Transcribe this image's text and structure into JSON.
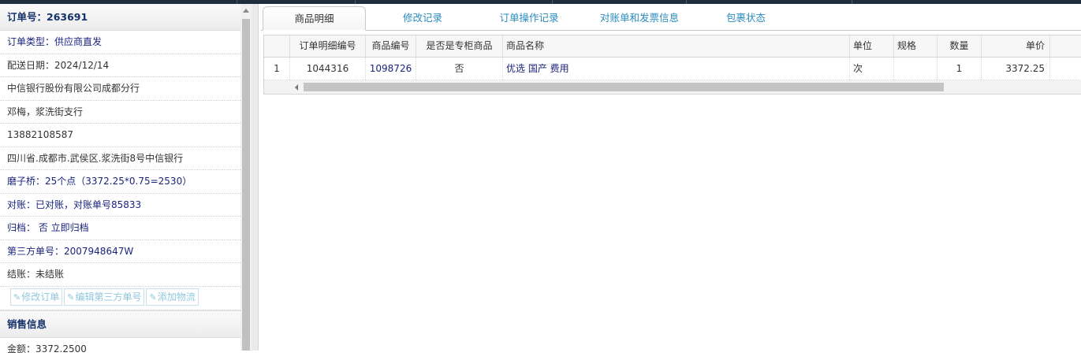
{
  "order": {
    "header": "订单号：263691",
    "rows": [
      {
        "text": "订单类型：供应商直发",
        "style": "blue"
      },
      {
        "text": "配送日期：2024/12/14",
        "style": "dark"
      },
      {
        "text": "中信银行股份有限公司成都分行",
        "style": "dark"
      },
      {
        "text": "邓梅，浆洗街支行",
        "style": "dark"
      },
      {
        "text": "13882108587",
        "style": "dark"
      },
      {
        "text": "四川省.成都市.武侯区.浆洗街8号中信银行",
        "style": "dark"
      },
      {
        "text": "磨子桥：25个点（3372.25*0.75=2530）",
        "style": "blue"
      },
      {
        "text": "对账：已对账，对账单号85833",
        "style": "blue"
      },
      {
        "text": "归档： 否 立即归档",
        "style": "blue"
      },
      {
        "text": "第三方单号：2007948647W",
        "style": "blue"
      },
      {
        "text": "结账：未结账",
        "style": "dark"
      }
    ],
    "buttons": {
      "edit_order": "修改订单",
      "edit_third_party": "编辑第三方单号",
      "add_logistics": "添加物流"
    }
  },
  "sales": {
    "header": "销售信息",
    "amount": "金额：3372.2500"
  },
  "tabs": [
    "商品明细",
    "修改记录",
    "订单操作记录",
    "对账单和发票信息",
    "包裹状态"
  ],
  "grid": {
    "columns": [
      "订单明细编号",
      "商品编号",
      "是否是专柜商品",
      "商品名称",
      "单位",
      "规格",
      "数量",
      "单价"
    ],
    "rows": [
      {
        "index": "1",
        "detail_no": "1044316",
        "product_no": "1098726",
        "counter": "否",
        "name": "优选 国产 费用",
        "unit": "次",
        "spec": "",
        "qty": "1",
        "price": "3372.25"
      }
    ]
  },
  "colors": {
    "link": "#1a237e",
    "tab": "#2a8bbf",
    "button": "#8fc6de"
  }
}
